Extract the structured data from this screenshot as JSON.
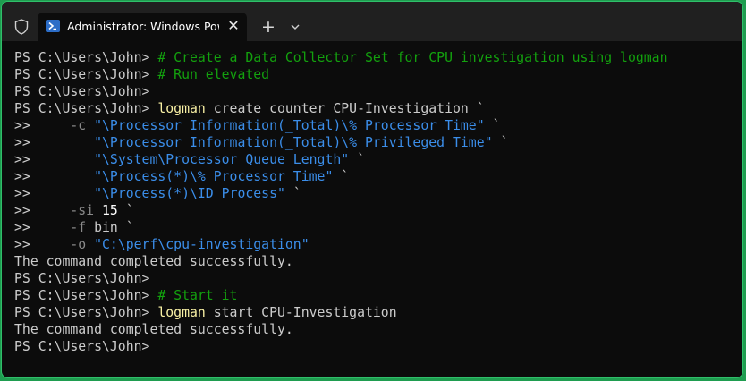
{
  "tab": {
    "title": "Administrator: Windows PowerShell"
  },
  "titlebar": {
    "close_glyph": "✕",
    "new_tab_glyph": "+"
  },
  "colors": {
    "accent_border": "#2fbf6a",
    "terminal_bg": "#0c0c0c",
    "comment": "#13a10e",
    "command": "#f9f1a5",
    "string": "#3b8eea",
    "parameter": "#8a8a8a"
  },
  "icons": {
    "shield": "shield-icon",
    "powershell": "powershell-icon",
    "close": "close-icon",
    "plus": "plus-icon",
    "chevron": "chevron-down-icon"
  },
  "terminal": {
    "lines": [
      [
        {
          "t": "PS C:\\Users\\John> ",
          "c": "plain"
        },
        {
          "t": "# Create a Data Collector Set for CPU investigation using logman",
          "c": "comment"
        }
      ],
      [
        {
          "t": "PS C:\\Users\\John> ",
          "c": "plain"
        },
        {
          "t": "# Run elevated",
          "c": "comment"
        }
      ],
      [
        {
          "t": "PS C:\\Users\\John>",
          "c": "plain"
        }
      ],
      [
        {
          "t": "PS C:\\Users\\John> ",
          "c": "plain"
        },
        {
          "t": "logman",
          "c": "cmd"
        },
        {
          "t": " create counter CPU-Investigation `",
          "c": "plain"
        }
      ],
      [
        {
          "t": ">>     ",
          "c": "plain"
        },
        {
          "t": "-c ",
          "c": "param"
        },
        {
          "t": "\"\\Processor Information(_Total)\\% Processor Time\"",
          "c": "string"
        },
        {
          "t": " `",
          "c": "plain"
        }
      ],
      [
        {
          "t": ">>        ",
          "c": "plain"
        },
        {
          "t": "\"\\Processor Information(_Total)\\% Privileged Time\"",
          "c": "string"
        },
        {
          "t": " `",
          "c": "plain"
        }
      ],
      [
        {
          "t": ">>        ",
          "c": "plain"
        },
        {
          "t": "\"\\System\\Processor Queue Length\"",
          "c": "string"
        },
        {
          "t": " `",
          "c": "plain"
        }
      ],
      [
        {
          "t": ">>        ",
          "c": "plain"
        },
        {
          "t": "\"\\Process(*)\\% Processor Time\"",
          "c": "string"
        },
        {
          "t": " `",
          "c": "plain"
        }
      ],
      [
        {
          "t": ">>        ",
          "c": "plain"
        },
        {
          "t": "\"\\Process(*)\\ID Process\"",
          "c": "string"
        },
        {
          "t": " `",
          "c": "plain"
        }
      ],
      [
        {
          "t": ">>     ",
          "c": "plain"
        },
        {
          "t": "-si ",
          "c": "param"
        },
        {
          "t": "15",
          "c": "number"
        },
        {
          "t": " `",
          "c": "plain"
        }
      ],
      [
        {
          "t": ">>     ",
          "c": "plain"
        },
        {
          "t": "-f ",
          "c": "param"
        },
        {
          "t": "bin `",
          "c": "plain"
        }
      ],
      [
        {
          "t": ">>     ",
          "c": "plain"
        },
        {
          "t": "-o ",
          "c": "param"
        },
        {
          "t": "\"C:\\perf\\cpu-investigation\"",
          "c": "string"
        }
      ],
      [
        {
          "t": "The command completed successfully.",
          "c": "plain"
        }
      ],
      [
        {
          "t": "PS C:\\Users\\John>",
          "c": "plain"
        }
      ],
      [
        {
          "t": "PS C:\\Users\\John> ",
          "c": "plain"
        },
        {
          "t": "# Start it",
          "c": "comment"
        }
      ],
      [
        {
          "t": "PS C:\\Users\\John> ",
          "c": "plain"
        },
        {
          "t": "logman",
          "c": "cmd"
        },
        {
          "t": " start CPU-Investigation",
          "c": "plain"
        }
      ],
      [
        {
          "t": "The command completed successfully.",
          "c": "plain"
        }
      ],
      [
        {
          "t": "PS C:\\Users\\John>",
          "c": "plain"
        }
      ]
    ]
  }
}
